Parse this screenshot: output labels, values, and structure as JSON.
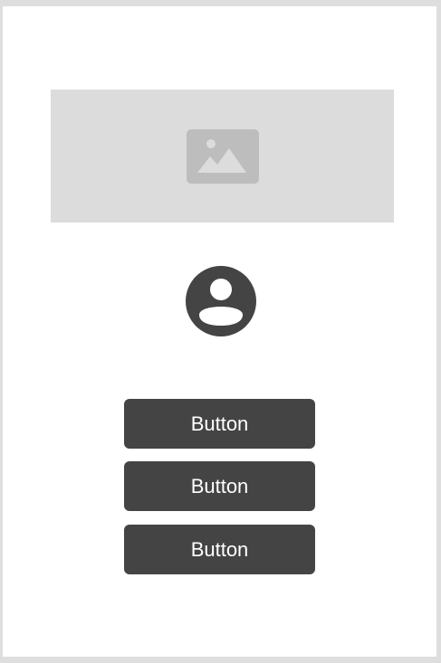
{
  "buttons": [
    {
      "label": "Button"
    },
    {
      "label": "Button"
    },
    {
      "label": "Button"
    }
  ],
  "icons": {
    "hero": "image-icon",
    "profile": "user-avatar-icon"
  },
  "colors": {
    "page_background": "#dedede",
    "card_background": "#ffffff",
    "placeholder_background": "#dcdcdc",
    "placeholder_icon": "#bdbdbd",
    "button_background": "#444444",
    "button_text": "#ffffff",
    "avatar": "#444444"
  }
}
